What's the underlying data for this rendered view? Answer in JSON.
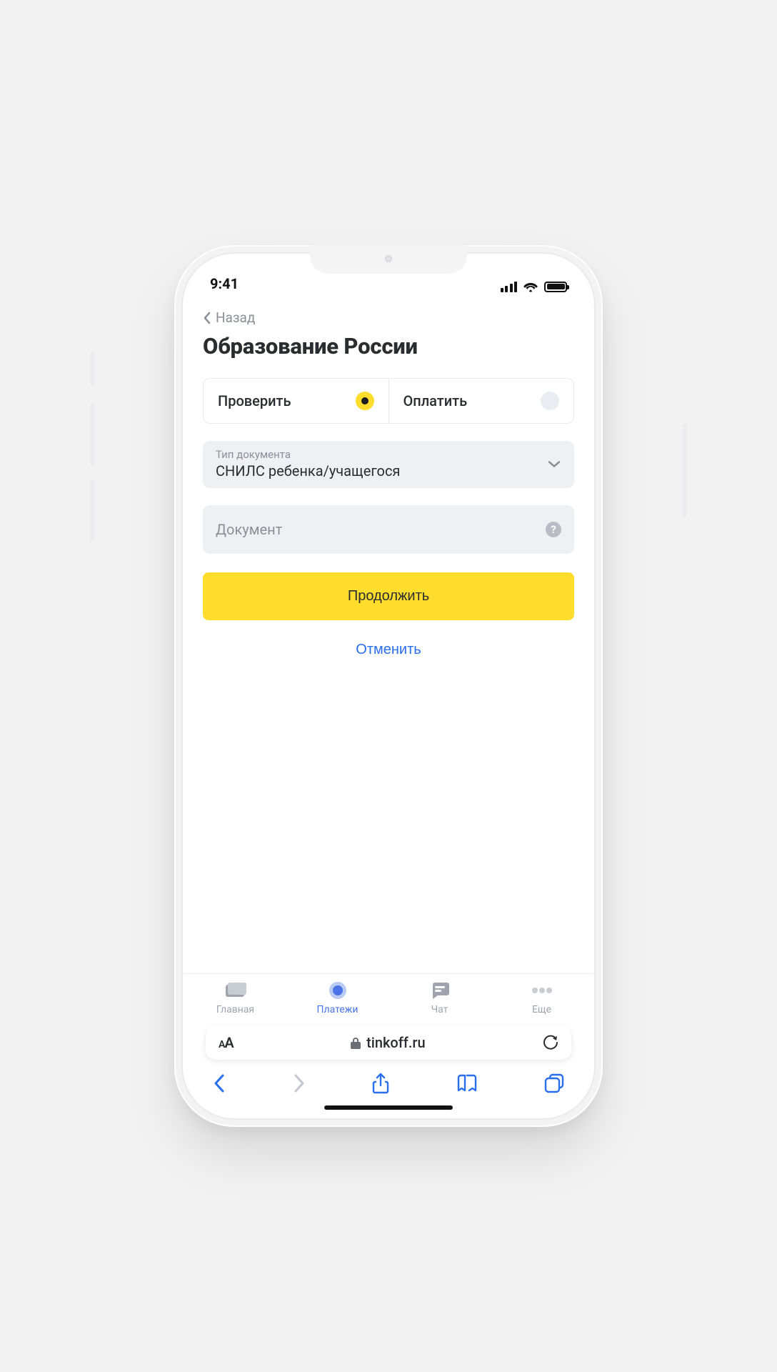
{
  "status": {
    "time": "9:41"
  },
  "header": {
    "back_label": "Назад",
    "title": "Образование России"
  },
  "segmented": {
    "check_label": "Проверить",
    "pay_label": "Оплатить",
    "selected": "check"
  },
  "doc_type": {
    "label": "Тип документа",
    "value": "СНИЛС ребенка/учащегося"
  },
  "doc_input": {
    "placeholder": "Документ"
  },
  "actions": {
    "continue_label": "Продолжить",
    "cancel_label": "Отменить"
  },
  "tabs": {
    "home": "Главная",
    "payments": "Платежи",
    "chat": "Чат",
    "more": "Еще"
  },
  "safari": {
    "host": "tinkoff.ru"
  }
}
